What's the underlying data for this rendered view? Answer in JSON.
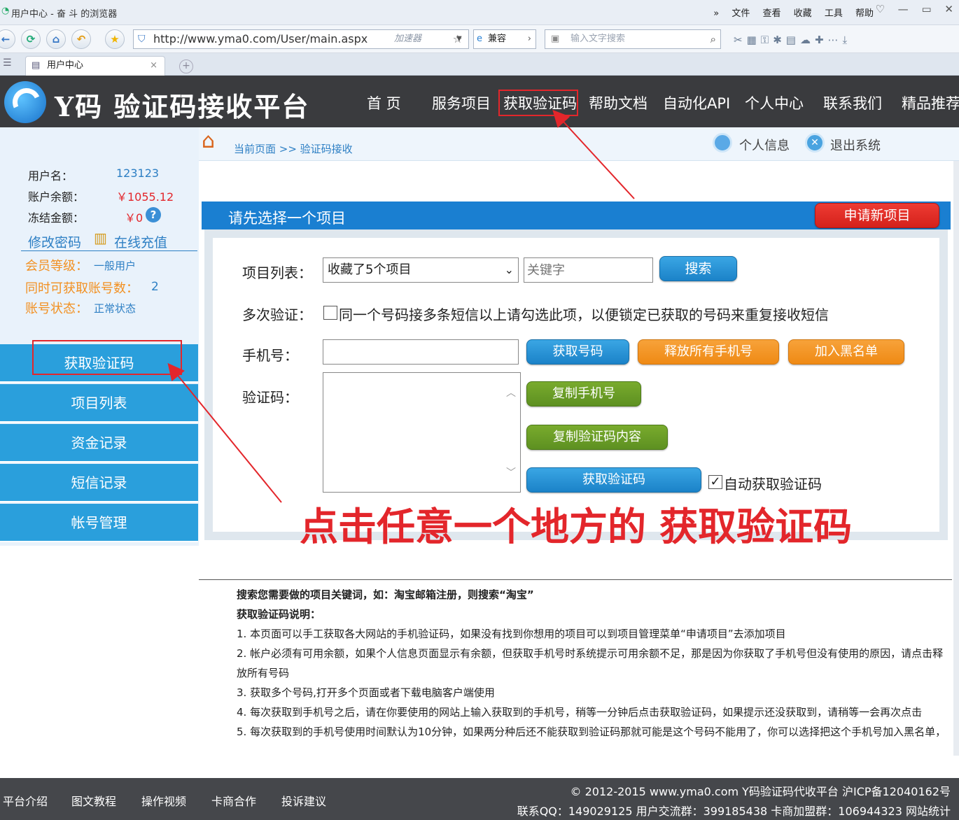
{
  "browser": {
    "window_title": "用户中心 - 奋 斗 的浏览器",
    "menu": [
      "文件",
      "查看",
      "收藏",
      "工具",
      "帮助"
    ],
    "url": "http://www.yma0.com/User/main.aspx",
    "accelerator": "加速器",
    "compat": "兼容",
    "search_placeholder": "输入文字搜索",
    "tab_title": "用户中心"
  },
  "site": {
    "logo_text": "Y码 验证码接收平台",
    "nav": [
      "首 页",
      "服务项目",
      "获取验证码",
      "帮助文档",
      "自动化API",
      "个人中心",
      "联系我们",
      "精品推荐"
    ]
  },
  "breadcrumb": {
    "text": "当前页面 >> 验证码接收",
    "personal_info": "个人信息",
    "logout": "退出系统"
  },
  "user": {
    "username_label": "用户名：",
    "username": "123123",
    "balance_label": "账户余额：",
    "balance": "￥1055.12",
    "frozen_label": "冻结金额：",
    "frozen": "￥0",
    "change_password": "修改密码",
    "recharge": "在线充值",
    "level_label": "会员等级：",
    "level": "一般用户",
    "concurrent_label": "同时可获取账号数：",
    "concurrent": "2",
    "status_label": "账号状态：",
    "status": "正常状态"
  },
  "sidebar_menu": [
    "获取验证码",
    "项目列表",
    "资金记录",
    "短信记录",
    "帐号管理"
  ],
  "panel": {
    "header": "请先选择一个项目",
    "apply_button": "申请新项目",
    "project_label": "项目列表：",
    "project_selected": "收藏了5个项目",
    "keyword_placeholder": "关键字",
    "search_button": "搜索",
    "multi_label": "多次验证：",
    "multi_text": "同一个号码接多条短信以上请勾选此项，以便锁定已获取的号码来重复接收短信",
    "phone_label": "手机号：",
    "get_number": "获取号码",
    "release_all": "释放所有手机号",
    "blacklist": "加入黑名单",
    "code_label": "验证码：",
    "copy_phone": "复制手机号",
    "copy_code": "复制验证码内容",
    "get_code": "获取验证码",
    "auto_get": "自动获取验证码"
  },
  "annotation": "点击任意一个地方的 获取验证码",
  "notes": {
    "line1": "搜索您需要做的项目关键词，如：淘宝邮箱注册，则搜索“淘宝”",
    "line2": "获取验证码说明：",
    "items": [
      "1. 本页面可以手工获取各大网站的手机验证码，如果没有找到你想用的项目可以到项目管理菜单“申请项目”去添加项目",
      "2. 帐户必须有可用余额，如果个人信息页面显示有余额，但获取手机号时系统提示可用余额不足，那是因为你获取了手机号但没有使用的原因，请点击释放所有号码",
      "3. 获取多个号码,打开多个页面或者下载电脑客户端使用",
      "4. 每次获取到手机号之后，请在你要使用的网站上输入获取到的手机号，稍等一分钟后点击获取验证码，如果提示还没获取到，请稍等一会再次点击",
      "5. 每次获取到的手机号使用时间默认为10分钟，如果两分种后还不能获取到验证码那就可能是这个号码不能用了，你可以选择把这个手机号加入黑名单，"
    ]
  },
  "footer": {
    "links": [
      "平台介绍",
      "图文教程",
      "操作视频",
      "卡商合作",
      "投诉建议"
    ],
    "copyright": "© 2012-2015 www.yma0.com Y码验证码代收平台 沪ICP备12040162号",
    "contact": "联系QQ：149029125 用户交流群：399185438 卡商加盟群：106944323 网站统计"
  },
  "colors": {
    "header_bg": "#3a3b3e",
    "sidebar_button": "#2a9fdc",
    "panel_header": "#1a7fd1",
    "highlight": "#e3262b"
  }
}
